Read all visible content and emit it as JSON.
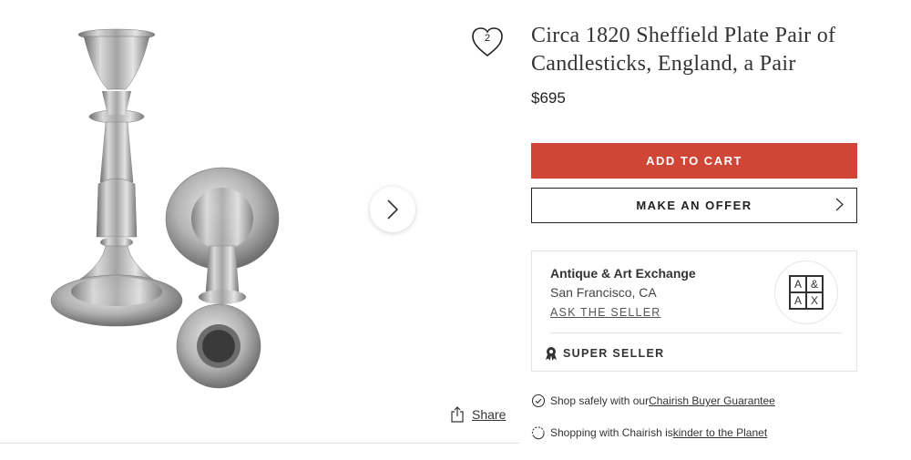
{
  "product": {
    "title": "Circa 1820 Sheffield Plate Pair of Candlesticks, England, a Pair",
    "price": "$695",
    "favorite_count": "2"
  },
  "gallery": {
    "share_label": "Share",
    "icons": {
      "next": "chevron-right-icon",
      "share": "share-icon",
      "favorite": "heart-icon"
    }
  },
  "actions": {
    "add_to_cart": "ADD TO CART",
    "make_offer": "MAKE AN OFFER"
  },
  "seller": {
    "name": "Antique & Art Exchange",
    "location": "San Francisco, CA",
    "ask_label": "ASK THE SELLER",
    "badge_label": "SUPER SELLER",
    "logo_letters": [
      "A",
      "&",
      "A",
      "X"
    ]
  },
  "assurances": [
    {
      "prefix": "Shop safely with our ",
      "link": "Chairish Buyer Guarantee",
      "icon": "check-circle-icon"
    },
    {
      "prefix": "Shopping with Chairish is ",
      "link": "kinder to the Planet",
      "icon": "recycle-icon"
    }
  ],
  "colors": {
    "accent": "#cf4536",
    "text": "#222222",
    "border": "#e3e3e3"
  }
}
